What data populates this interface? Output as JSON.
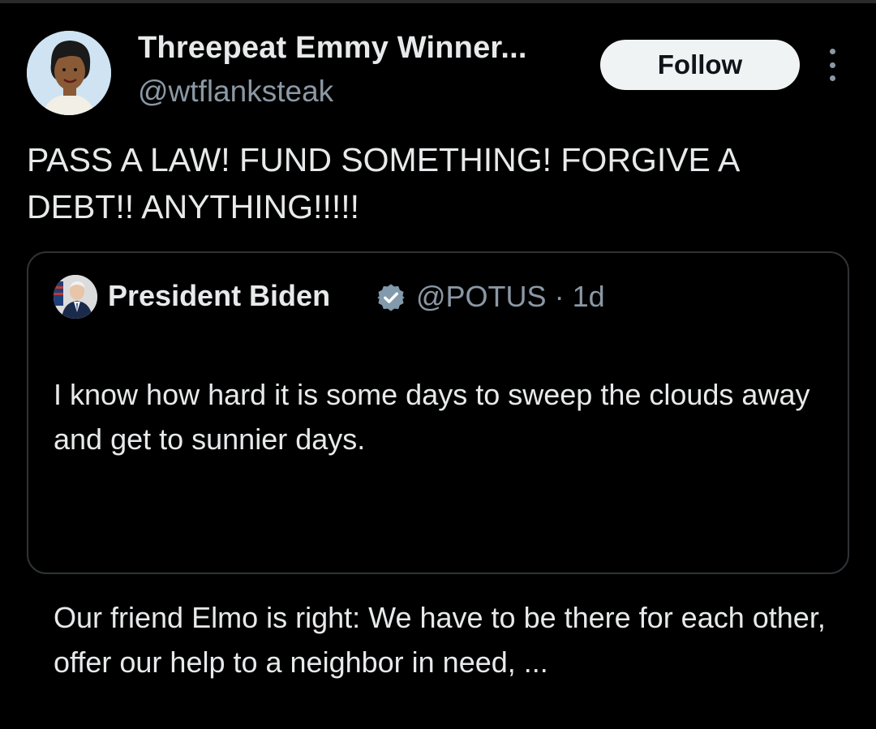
{
  "tweet": {
    "author": {
      "display_name": "Threepeat Emmy Winner...",
      "handle": "@wtflanksteak",
      "avatar_icon": "cartoon-woman-avatar"
    },
    "follow_label": "Follow",
    "more_icon": "more-vertical-icon",
    "text": "PASS A LAW! FUND SOMETHING! FORGIVE A DEBT!! ANYTHING!!!!!"
  },
  "quoted_tweet": {
    "author": {
      "display_name": "President Biden",
      "verified_icon": "verified-badge-icon",
      "handle": "@POTUS",
      "separator": "·",
      "time": "1d"
    },
    "paragraph_1": "I know how hard it is some days to sweep the clouds away and get to sunnier days.",
    "paragraph_2": "Our friend Elmo is right: We have to be there for each other, offer our help to a neighbor in need, ..."
  },
  "colors": {
    "background": "#000000",
    "primary_text": "#e7e9ea",
    "secondary_text": "#8b98a5",
    "border": "#2f3336",
    "follow_bg": "#eff3f4",
    "verified_badge": "#829aab"
  }
}
